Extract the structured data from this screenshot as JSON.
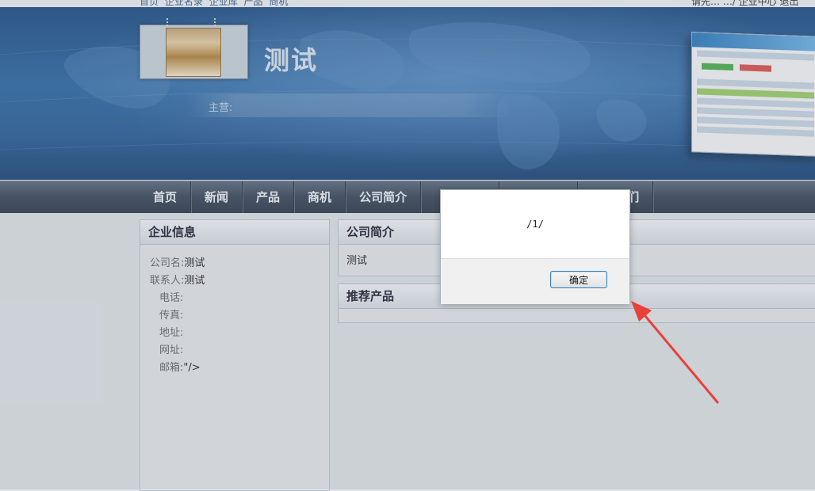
{
  "topbar": {
    "links": [
      "首页",
      "企业名录",
      "企业库",
      "产品",
      "商机"
    ],
    "right_text": "请先…   …/ 企业中心   退出"
  },
  "banner": {
    "site_title": "测试",
    "main_business_label": "主营:"
  },
  "nav": {
    "items": [
      "首页",
      "新闻",
      "产品",
      "商机",
      "公司简介",
      "",
      "",
      "联系我们"
    ]
  },
  "company_info": {
    "heading": "企业信息",
    "rows": [
      {
        "key": "公司名:",
        "value": "测试"
      },
      {
        "key": "联系人:",
        "value": "测试"
      },
      {
        "key": "电话:",
        "value": ""
      },
      {
        "key": "传真:",
        "value": ""
      },
      {
        "key": "地址:",
        "value": ""
      },
      {
        "key": "网址:",
        "value": ""
      },
      {
        "key": "邮箱:",
        "value": "\"/>"
      }
    ]
  },
  "company_intro": {
    "heading": "公司简介",
    "text": "测试"
  },
  "recommended": {
    "heading": "推荐产品"
  },
  "dialog": {
    "message": "/1/",
    "ok_label": "确定"
  },
  "colors": {
    "banner": "#2e6aa6",
    "nav": "#3c4a5c",
    "arrow": "#e8413a",
    "dialog_button_border": "#3c7fb1"
  }
}
